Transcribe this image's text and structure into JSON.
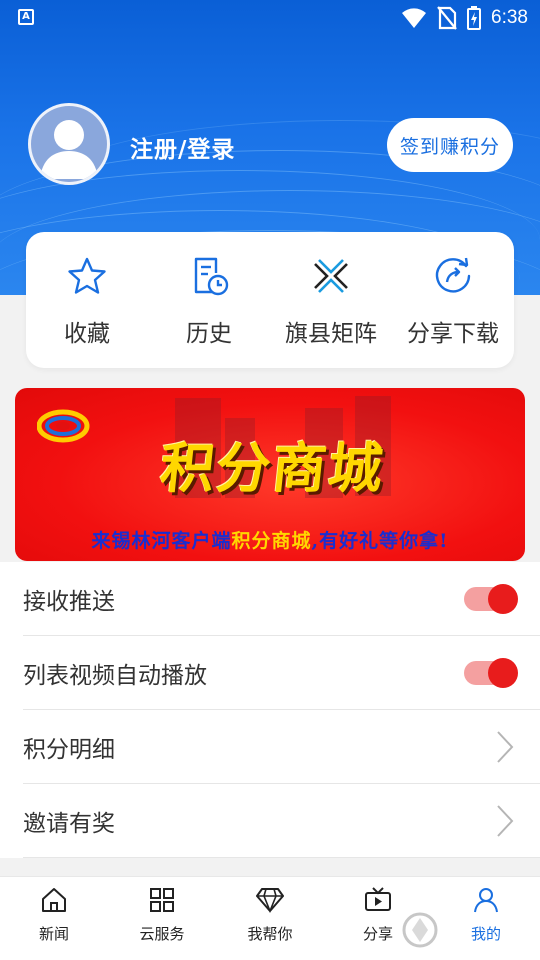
{
  "status_bar": {
    "time": "6:38",
    "a_icon": "A"
  },
  "profile": {
    "login_label": "注册/登录",
    "signin_button": "签到赚积分"
  },
  "shortcuts": [
    {
      "icon": "star-icon",
      "label": "收藏"
    },
    {
      "icon": "history-icon",
      "label": "历史"
    },
    {
      "icon": "matrix-icon",
      "label": "旗县矩阵"
    },
    {
      "icon": "share-download-icon",
      "label": "分享下载"
    }
  ],
  "banner": {
    "title": "积分商城",
    "subtitle_pre": "来锡林河客户端",
    "subtitle_hl": "积分商城",
    "subtitle_post": ",有好礼等你拿!"
  },
  "settings": [
    {
      "label": "接收推送",
      "type": "toggle",
      "on": true
    },
    {
      "label": "列表视频自动播放",
      "type": "toggle",
      "on": true
    },
    {
      "label": "积分明细",
      "type": "link"
    },
    {
      "label": "邀请有奖",
      "type": "link"
    }
  ],
  "tabs": [
    {
      "label": "新闻",
      "icon": "home-icon",
      "active": false
    },
    {
      "label": "云服务",
      "icon": "grid-icon",
      "active": false
    },
    {
      "label": "我帮你",
      "icon": "diamond-icon",
      "active": false
    },
    {
      "label": "分享",
      "icon": "video-icon",
      "active": false
    },
    {
      "label": "我的",
      "icon": "user-icon",
      "active": true
    }
  ],
  "colors": {
    "primary": "#1a6fe0",
    "toggle_on": "#e81c1c",
    "banner": "#f21010"
  }
}
